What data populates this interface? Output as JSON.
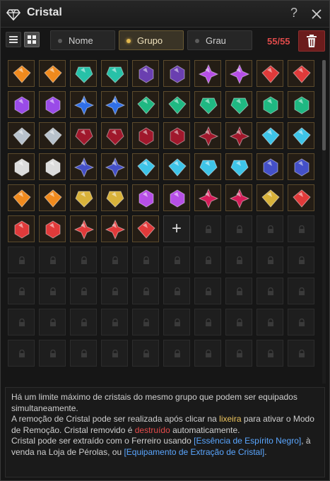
{
  "window": {
    "title": "Cristal",
    "help_label": "?",
    "icon": "diamond-icon"
  },
  "toolbar": {
    "tabs": [
      {
        "label": "Nome",
        "active": false
      },
      {
        "label": "Grupo",
        "active": true
      },
      {
        "label": "Grau",
        "active": false
      }
    ],
    "count": "55/55",
    "list_view_icon": "list-icon",
    "grid_view_icon": "grid-icon",
    "trash_icon": "trash-icon"
  },
  "grid": {
    "columns": 10,
    "visible_rows": 10,
    "filled": 55,
    "add_slot_label": "+",
    "crystals": [
      "orange",
      "orange",
      "teal",
      "teal",
      "purple-dark",
      "purple-dark",
      "violet",
      "violet",
      "red",
      "red",
      "purple",
      "purple",
      "blue",
      "blue",
      "green",
      "green",
      "green",
      "green",
      "green",
      "green",
      "grey",
      "grey",
      "crimson",
      "crimson",
      "crimson",
      "crimson",
      "crimson",
      "crimson",
      "cyan",
      "cyan",
      "white",
      "white",
      "navy",
      "navy",
      "cyan",
      "cyan",
      "cyan",
      "cyan",
      "navy",
      "navy",
      "orange",
      "orange",
      "gold",
      "gold",
      "violet",
      "violet",
      "ruby",
      "ruby",
      "gold",
      "red",
      "red",
      "red",
      "red",
      "red",
      "red"
    ]
  },
  "colors": {
    "orange": "#f08a1e",
    "teal": "#27c1a8",
    "purple-dark": "#6a3fb0",
    "violet": "#b64fe6",
    "red": "#e03a3a",
    "purple": "#9a4be8",
    "blue": "#2f6fe8",
    "green": "#1fb882",
    "grey": "#b8c2cc",
    "crimson": "#a0182c",
    "cyan": "#3ec4e8",
    "white": "#dcdcdc",
    "navy": "#4450c8",
    "gold": "#d9b23a",
    "ruby": "#d61c58",
    "count_red": "#e04a4a",
    "trash_bg": "#6b1c1c",
    "accent_gold": "#e2b84e"
  },
  "info": {
    "line1": "Há um limite máximo de cristais do mesmo grupo que podem ser equipados simultaneamente.",
    "line2_a": "A remoção de Cristal pode ser realizada após clicar na ",
    "line2_b": "lixeira",
    "line2_c": " para ativar o Modo de Remoção. Cristal removido é ",
    "line2_d": "destruído",
    "line2_e": " automaticamente.",
    "line3_a": "Cristal pode ser extraído com o Ferreiro usando ",
    "line3_b": "[Essência de Espírito Negro]",
    "line3_c": ", à venda na Loja de Pérolas, ou ",
    "line3_d": "[Equipamento de Extração de Cristal]",
    "line3_e": "."
  }
}
